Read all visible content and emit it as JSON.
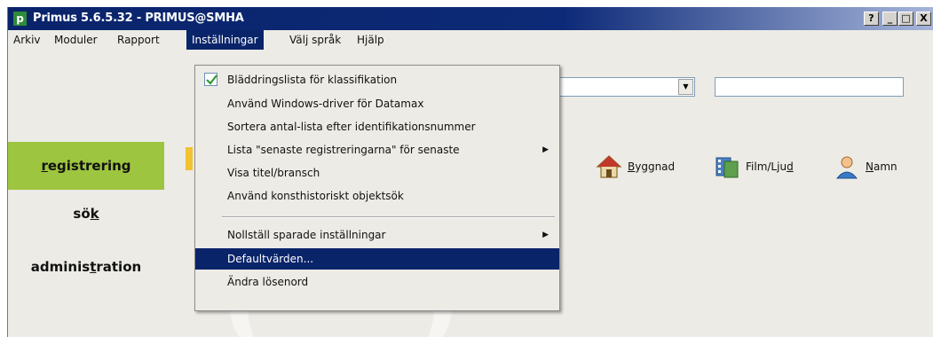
{
  "window": {
    "title": "Primus 5.6.5.32 - PRIMUS@SMHA",
    "app_icon_letter": "p",
    "controls": {
      "help": "?",
      "minimize": "_",
      "maximize": "□",
      "close": "X"
    }
  },
  "menubar": {
    "items": [
      {
        "label": "Arkiv"
      },
      {
        "label": "Moduler"
      },
      {
        "label": "Rapport"
      },
      {
        "label": "Inställningar",
        "active": true
      },
      {
        "label": "Välj språk"
      },
      {
        "label": "Hjälp"
      }
    ]
  },
  "dropdown": {
    "items": [
      {
        "label": "Bläddringslista för klassifikation",
        "checked": true
      },
      {
        "label": "Använd Windows-driver för Datamax"
      },
      {
        "label": "Sortera antal-lista efter identifikationsnummer"
      },
      {
        "label": "Lista \"senaste registreringarna\" för senaste",
        "submenu": true
      },
      {
        "label": "Visa titel/bransch"
      },
      {
        "label": "Använd konsthistoriskt objektsök"
      },
      {
        "label": "Nollställ sparade inställningar",
        "submenu": true
      },
      {
        "label": "Defaultvärden...",
        "highlighted": true
      },
      {
        "label": "Ändra lösenord"
      }
    ]
  },
  "nav": {
    "registrering": {
      "before": "",
      "mnemonic": "r",
      "after": "egistrering",
      "selected": true
    },
    "sok": {
      "before": "sö",
      "mnemonic": "k",
      "after": ""
    },
    "administration": {
      "before": "adminis",
      "mnemonic": "t",
      "after": "ration"
    }
  },
  "categories": [
    {
      "icon": "house-icon",
      "before": "",
      "mnemonic": "B",
      "after": "yggnad"
    },
    {
      "icon": "film-icon",
      "before": "Film/Lju",
      "mnemonic": "d",
      "after": ""
    },
    {
      "icon": "person-icon",
      "before": "",
      "mnemonic": "N",
      "after": "amn"
    }
  ],
  "colors": {
    "titlebar": "#0a246a",
    "nav_selected": "#9ec53f",
    "menu_highlight": "#0a246a"
  }
}
